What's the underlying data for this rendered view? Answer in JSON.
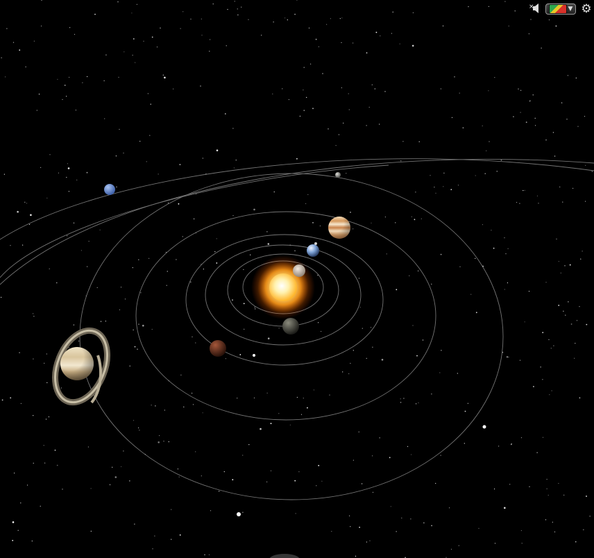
{
  "scene": {
    "type": "solar-system-3d-view",
    "background_color": "#000000",
    "orbit_color": "#8a8a8a",
    "bodies": [
      {
        "name": "sun-icon",
        "kind": "star",
        "color": "#ffd24a",
        "glow": "#ff8a00"
      },
      {
        "name": "mercury-icon",
        "kind": "planet",
        "color": "#6b6b5e"
      },
      {
        "name": "venus-icon",
        "kind": "planet",
        "color": "#d8c9b8"
      },
      {
        "name": "earth-icon",
        "kind": "planet",
        "color": "#5a86c9"
      },
      {
        "name": "mars-icon",
        "kind": "planet",
        "color": "#7a3a22"
      },
      {
        "name": "jupiter-icon",
        "kind": "planet",
        "color": "#d9a56a"
      },
      {
        "name": "saturn-icon",
        "kind": "planet",
        "color": "#d8c7a4",
        "ring_color": "#bdb39a"
      },
      {
        "name": "uranus-icon",
        "kind": "planet",
        "color": "#bdbdbd"
      },
      {
        "name": "neptune-icon",
        "kind": "planet",
        "color": "#6e95d9"
      }
    ]
  },
  "toolbar": {
    "mute_icon": "speaker-muted-icon",
    "layer_icon": "layer-switch-icon",
    "settings_icon": "gear-icon"
  }
}
